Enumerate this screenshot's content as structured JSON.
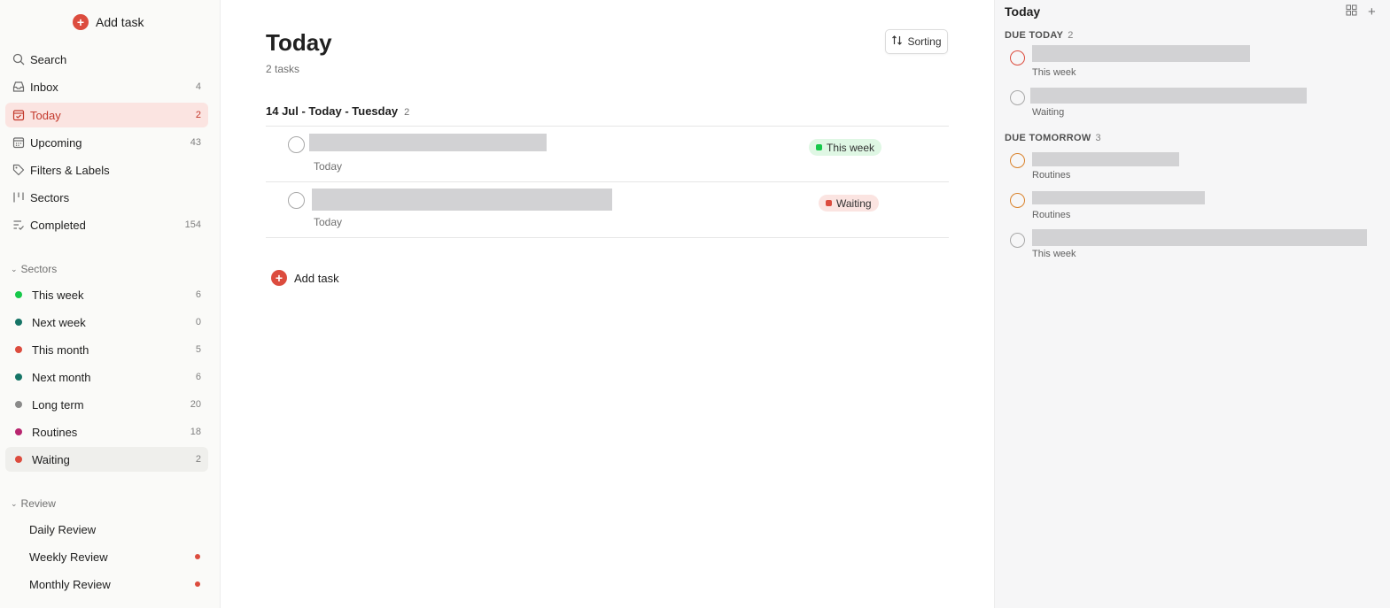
{
  "colors": {
    "accent": "#dc4c3e",
    "active_bg": "#fbe4e1",
    "this_week": "#16c84a",
    "this_week_chip_bg": "#dff7e4",
    "waiting": "#dc4c3e",
    "waiting_chip_bg": "#fbe4e1",
    "priority_red": "#dc4c3e",
    "priority_orange": "#d9822b"
  },
  "sidebar": {
    "add_task": "Add task",
    "nav": [
      {
        "label": "Search",
        "count": "",
        "icon": "search-icon"
      },
      {
        "label": "Inbox",
        "count": "4",
        "icon": "inbox-icon"
      },
      {
        "label": "Today",
        "count": "2",
        "icon": "calendar-today-icon"
      },
      {
        "label": "Upcoming",
        "count": "43",
        "icon": "calendar-icon"
      },
      {
        "label": "Filters & Labels",
        "count": "",
        "icon": "tag-icon"
      },
      {
        "label": "Sectors",
        "count": "",
        "icon": "board-icon"
      },
      {
        "label": "Completed",
        "count": "154",
        "icon": "checklist-icon"
      }
    ],
    "sectors_title": "Sectors",
    "sectors": [
      {
        "label": "This week",
        "count": "6",
        "color": "#16c84a"
      },
      {
        "label": "Next week",
        "count": "0",
        "color": "#157466"
      },
      {
        "label": "This month",
        "count": "5",
        "color": "#dc4c3e"
      },
      {
        "label": "Next month",
        "count": "6",
        "color": "#157466"
      },
      {
        "label": "Long term",
        "count": "20",
        "color": "#8a8a8a"
      },
      {
        "label": "Routines",
        "count": "18",
        "color": "#b8256f"
      },
      {
        "label": "Waiting",
        "count": "2",
        "color": "#dc4c3e"
      }
    ],
    "review_title": "Review",
    "review": [
      {
        "label": "Daily Review"
      },
      {
        "label": "Weekly Review"
      },
      {
        "label": "Monthly Review"
      }
    ]
  },
  "main": {
    "title": "Today",
    "task_count": "2 tasks",
    "sorting": "Sorting",
    "group_title": "14 Jul - Today - Tuesday",
    "group_count": "2",
    "tasks": [
      {
        "due": "Today",
        "label": "This week"
      },
      {
        "due": "Today",
        "label": "Waiting"
      }
    ],
    "add_task": "Add task"
  },
  "right": {
    "title": "Today",
    "due_today": "DUE TODAY",
    "due_today_count": "2",
    "due_tomorrow": "DUE TOMORROW",
    "due_tomorrow_count": "3",
    "today_items": [
      {
        "sub": "This week"
      },
      {
        "sub": "Waiting"
      }
    ],
    "tomorrow_items": [
      {
        "sub": "Routines"
      },
      {
        "sub": "Routines"
      },
      {
        "sub": "This week"
      }
    ]
  }
}
